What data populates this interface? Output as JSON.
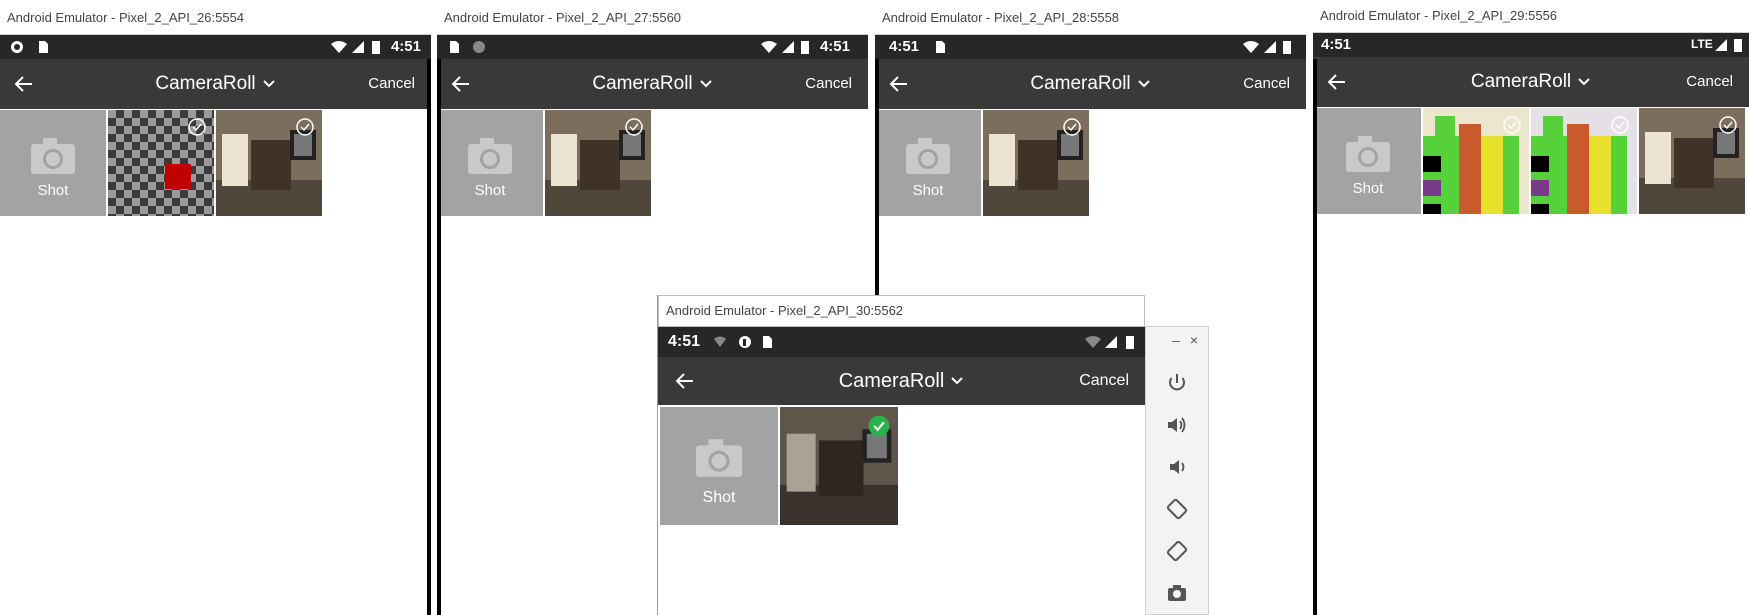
{
  "emulators": [
    {
      "id": "api26",
      "window_title": "Android Emulator - Pixel_2_API_26:5554",
      "time": "4:51",
      "network": "",
      "title": "CameraRoll",
      "cancel": "Cancel",
      "shot": "Shot",
      "images": [
        "checker-red",
        "room"
      ]
    },
    {
      "id": "api27",
      "window_title": "Android Emulator - Pixel_2_API_27:5560",
      "time": "4:51",
      "network": "",
      "title": "CameraRoll",
      "cancel": "Cancel",
      "shot": "Shot",
      "images": [
        "room"
      ]
    },
    {
      "id": "api28",
      "window_title": "Android Emulator - Pixel_2_API_28:5558",
      "time": "4:51",
      "network": "",
      "title": "CameraRoll",
      "cancel": "Cancel",
      "shot": "Shot",
      "images": [
        "room"
      ]
    },
    {
      "id": "api29",
      "window_title": "Android Emulator - Pixel_2_API_29:5556",
      "time": "4:51",
      "network": "LTE",
      "title": "CameraRoll",
      "cancel": "Cancel",
      "shot": "Shot",
      "images": [
        "colorbars",
        "colorbars",
        "room"
      ]
    },
    {
      "id": "api30",
      "window_title": "Android Emulator - Pixel_2_API_30:5562",
      "time": "4:51",
      "network": "",
      "title": "CameraRoll",
      "cancel": "Cancel",
      "shot": "Shot",
      "images": [
        "room-selected"
      ]
    }
  ],
  "side_panel": {
    "controls": [
      "minimize-icon",
      "close-icon"
    ],
    "buttons": [
      "power-icon",
      "volume-up-icon",
      "volume-down-icon",
      "rotate-left-icon",
      "rotate-right-icon",
      "camera-icon"
    ]
  },
  "colors": {
    "status_bar": "#272727",
    "app_bar": "#393939",
    "shot_tile": "#a3a3a3",
    "check_selected": "#2bb14a"
  }
}
